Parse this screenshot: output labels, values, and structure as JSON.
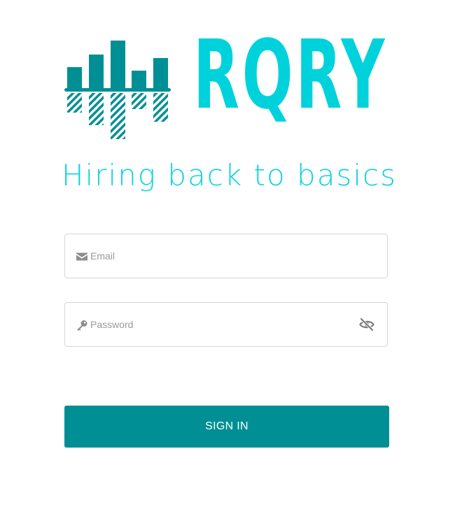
{
  "brand": {
    "name": "RQRY",
    "tagline": "Hiring back to basics",
    "primary_color": "#00d2dc",
    "mark_color": "#008f94",
    "logo_icon": "bar-chart-mirror-logo"
  },
  "form": {
    "email": {
      "placeholder": "Email",
      "value": "",
      "icon": "envelope-icon"
    },
    "password": {
      "placeholder": "Password",
      "value": "",
      "icon": "key-icon",
      "toggle_icon": "eye-slash-icon"
    },
    "submit_label": "SIGN IN",
    "submit_color": "#008f94"
  }
}
